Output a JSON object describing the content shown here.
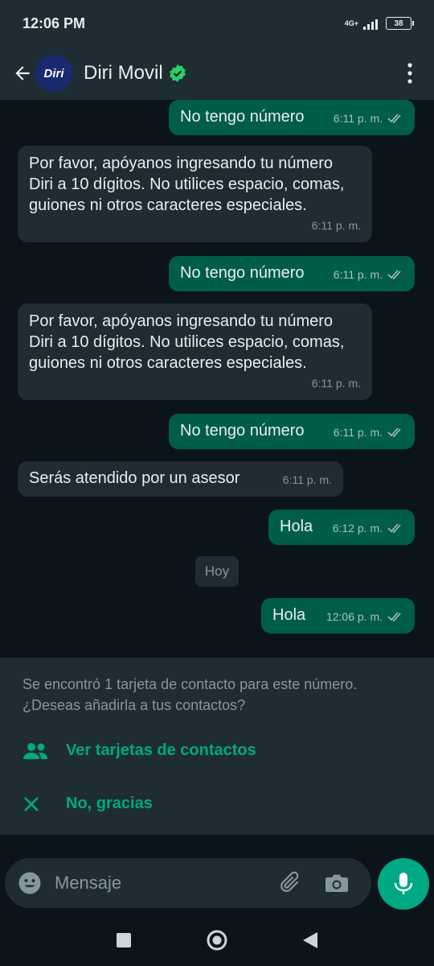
{
  "status_bar": {
    "time": "12:06 PM",
    "network": "4G+",
    "battery": "38"
  },
  "header": {
    "contact_name": "Diri Movil",
    "avatar_text": "Diri",
    "icons": [
      "back-arrow-icon",
      "verified-badge-icon",
      "more-vertical-icon"
    ]
  },
  "messages": [
    {
      "direction": "out",
      "text": "No tengo número",
      "time": "6:11 p. m."
    },
    {
      "direction": "in",
      "text": "Por favor, apóyanos ingresando tu número Diri a 10 dígitos. No utilices espacio, comas, guiones ni otros caracteres especiales.",
      "time": "6:11 p. m."
    },
    {
      "direction": "out",
      "text": "No tengo número",
      "time": "6:11 p. m."
    },
    {
      "direction": "in",
      "text": "Por favor, apóyanos ingresando tu número Diri a 10 dígitos. No utilices espacio, comas, guiones ni otros caracteres especiales.",
      "time": "6:11 p. m."
    },
    {
      "direction": "out",
      "text": "No tengo número",
      "time": "6:11 p. m."
    },
    {
      "direction": "in",
      "text": "Serás atendido por un asesor",
      "time": "6:11 p. m."
    },
    {
      "direction": "out",
      "text": "Hola",
      "time": "6:12 p. m."
    },
    {
      "direction": "out",
      "text": "Hola",
      "time": "12:06 p. m."
    }
  ],
  "date_divider": "Hoy",
  "contact_panel": {
    "message": "Se encontró 1 tarjeta de contacto para este número. ¿Deseas añadirla a tus contactos?",
    "view_label": "Ver tarjetas de contactos",
    "dismiss_label": "No, gracias"
  },
  "compose": {
    "placeholder": "Mensaje"
  },
  "colors": {
    "outgoing_bubble": "#005c4b",
    "incoming_bubble": "#1f2c34",
    "accent": "#00a884",
    "background": "#0b141a"
  }
}
